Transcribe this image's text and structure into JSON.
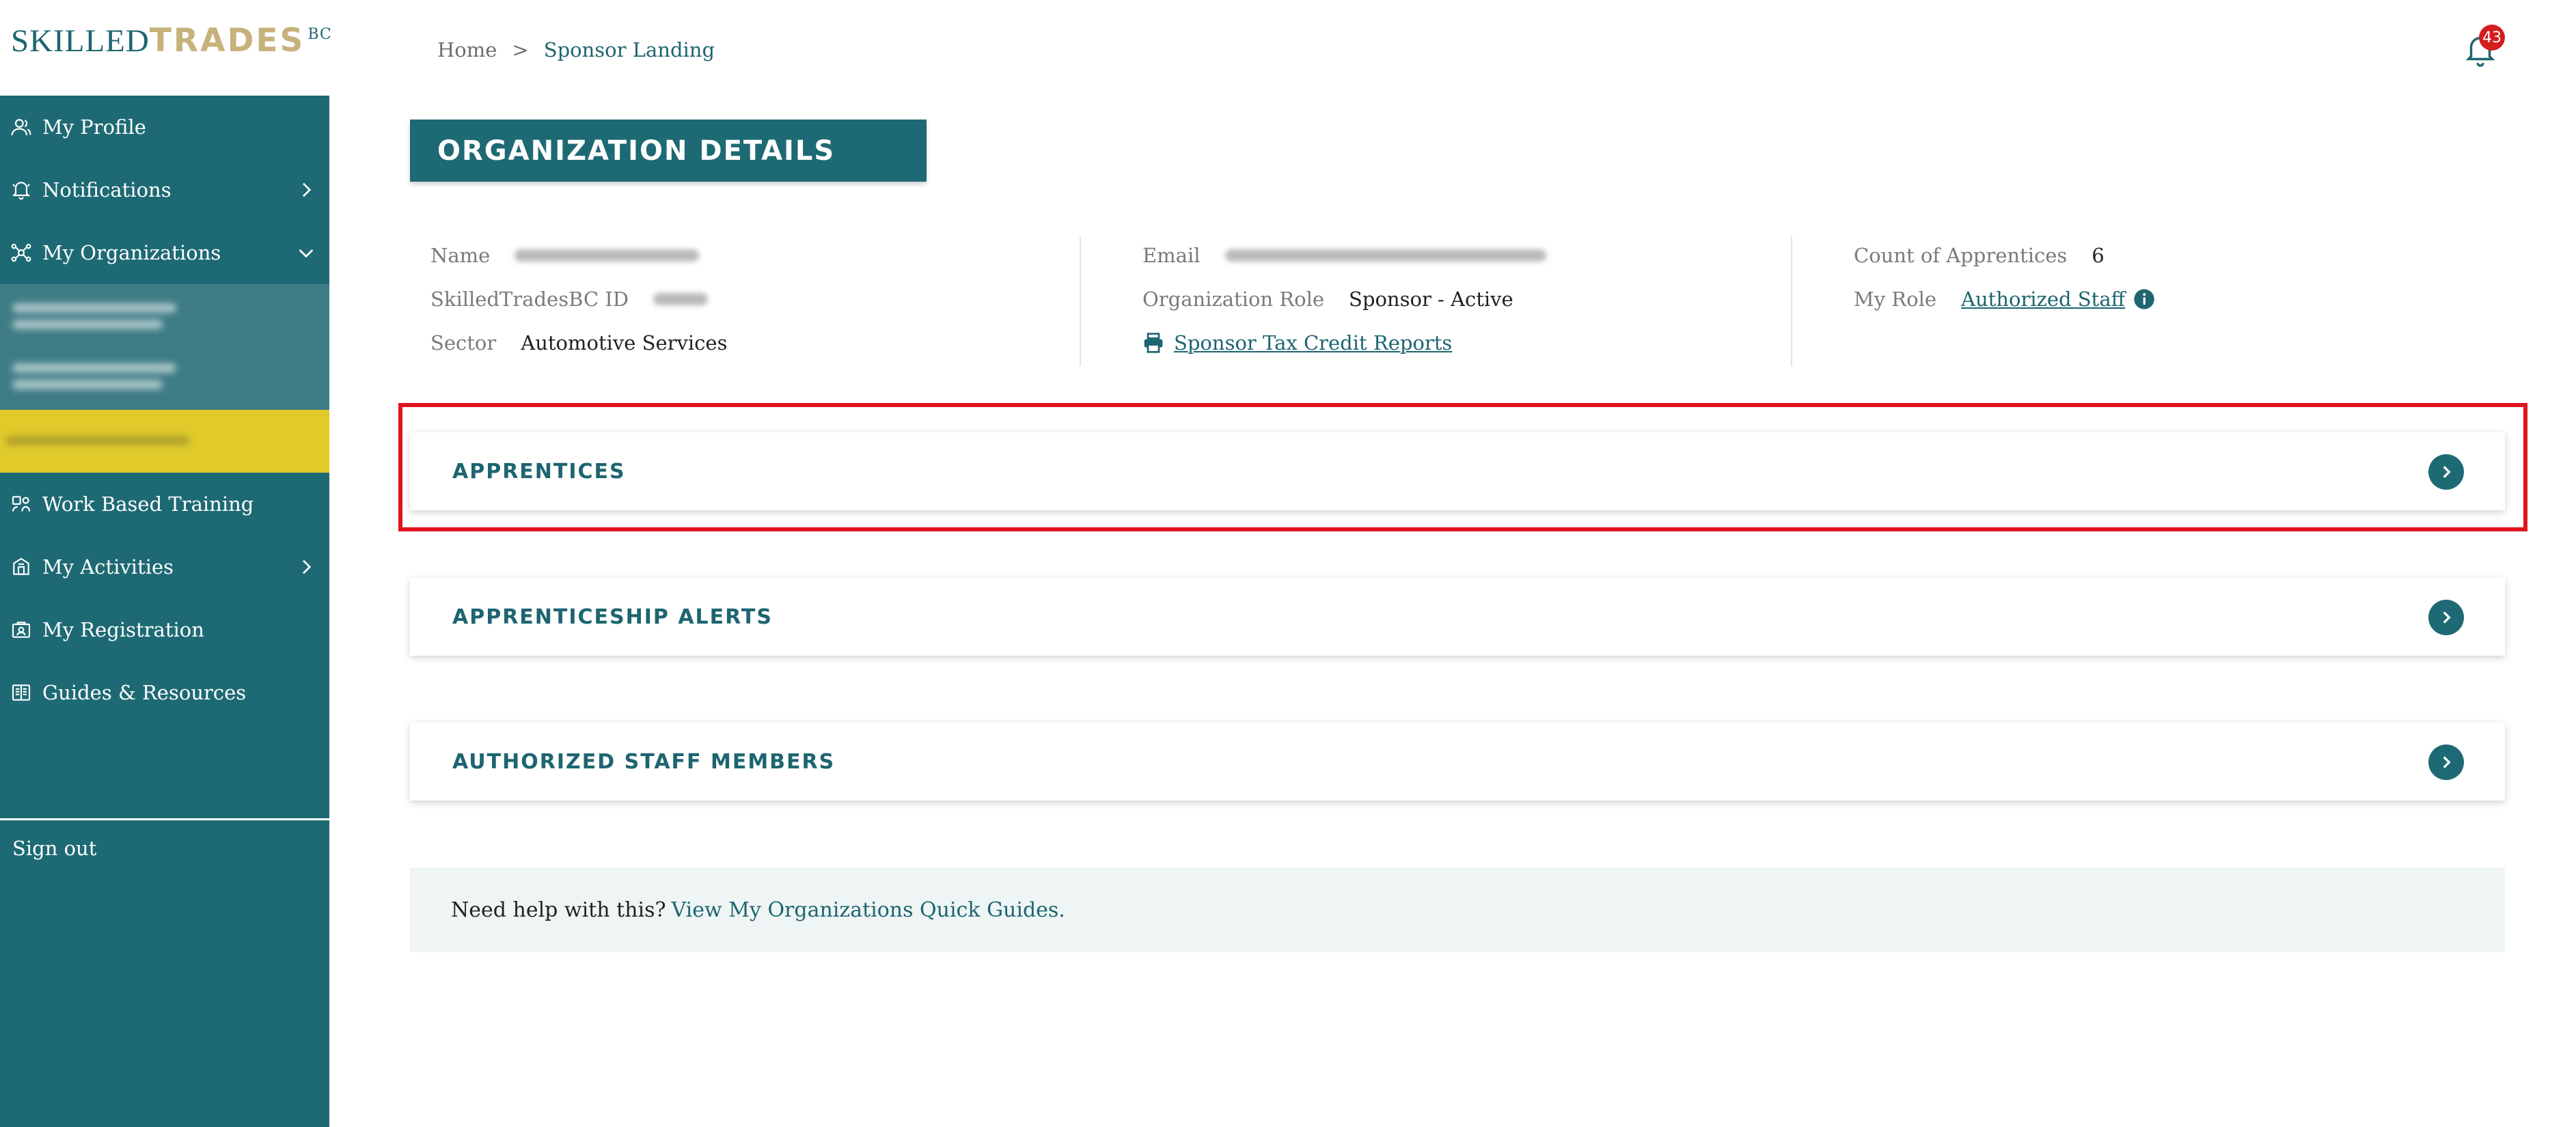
{
  "logo": {
    "part1": "SKILLED",
    "part2": "TRADES",
    "part3": "BC"
  },
  "sidebar": {
    "items": [
      {
        "label": "My Profile",
        "icon": "user-icon"
      },
      {
        "label": "Notifications",
        "icon": "bell-icon"
      },
      {
        "label": "My Organizations",
        "icon": "network-icon"
      },
      {
        "label": "Work Based Training",
        "icon": "training-icon"
      },
      {
        "label": "My Activities",
        "icon": "activities-icon"
      },
      {
        "label": "My Registration",
        "icon": "registration-icon"
      },
      {
        "label": "Guides & Resources",
        "icon": "book-icon"
      }
    ],
    "sign_out": "Sign out"
  },
  "breadcrumb": {
    "home": "Home",
    "separator": ">",
    "current": "Sponsor Landing"
  },
  "notifications": {
    "count": "43"
  },
  "page": {
    "title": "ORGANIZATION DETAILS"
  },
  "details": {
    "col1": {
      "name_label": "Name",
      "id_label": "SkilledTradesBC ID",
      "sector_label": "Sector",
      "sector_value": "Automotive Services"
    },
    "col2": {
      "email_label": "Email",
      "role_label": "Organization Role",
      "role_value": "Sponsor - Active",
      "report_link": "Sponsor Tax Credit Reports"
    },
    "col3": {
      "count_label": "Count of Apprentices",
      "count_value": "6",
      "my_role_label": "My Role",
      "my_role_value": "Authorized Staff"
    }
  },
  "sections": [
    {
      "title": "APPRENTICES"
    },
    {
      "title": "APPRENTICESHIP ALERTS"
    },
    {
      "title": "AUTHORIZED STAFF MEMBERS"
    }
  ],
  "help": {
    "question": "Need help with this?",
    "link": "View My Organizations Quick Guides."
  },
  "colors": {
    "primary": "#1e6a74",
    "accent_gold": "#c7b27c",
    "active_yellow": "#e0cb2b",
    "highlight_red": "#e0141d",
    "badge_red": "#d41d1d",
    "help_bg": "#eef5f4"
  }
}
